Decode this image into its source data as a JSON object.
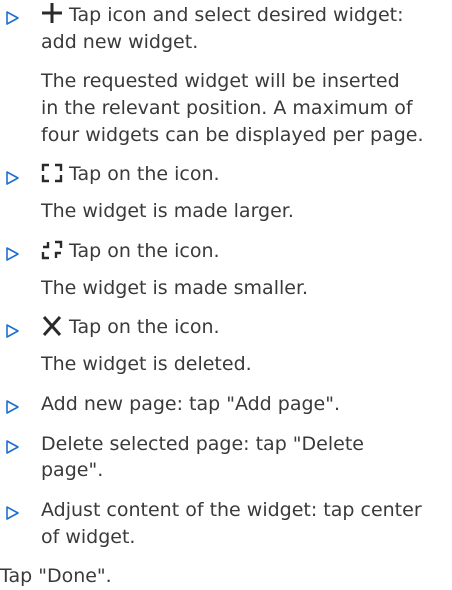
{
  "colors": {
    "text": "#3a3a3a",
    "bullet": "#1f6fd0"
  },
  "items": [
    {
      "icon": "plus-icon",
      "lines": [
        "Tap icon and select desired widget:",
        "add new widget."
      ],
      "detail": [
        "The requested widget will be inserted",
        "in the relevant position. A maximum of",
        "four widgets can be displayed per page."
      ]
    },
    {
      "icon": "enlarge-icon",
      "lines": [
        "Tap on the icon."
      ],
      "detail": [
        "The widget is made larger."
      ]
    },
    {
      "icon": "shrink-icon",
      "lines": [
        "Tap on the icon."
      ],
      "detail": [
        "The widget is made smaller."
      ]
    },
    {
      "icon": "close-icon",
      "lines": [
        "Tap on the icon."
      ],
      "detail": [
        "The widget is deleted."
      ]
    },
    {
      "lines": [
        "Add new page: tap \"Add page\"."
      ]
    },
    {
      "lines": [
        "Delete selected page: tap \"Delete",
        "page\"."
      ]
    },
    {
      "lines": [
        "Adjust content of the widget: tap center",
        "of widget."
      ]
    }
  ],
  "final_step": "Tap \"Done\"."
}
